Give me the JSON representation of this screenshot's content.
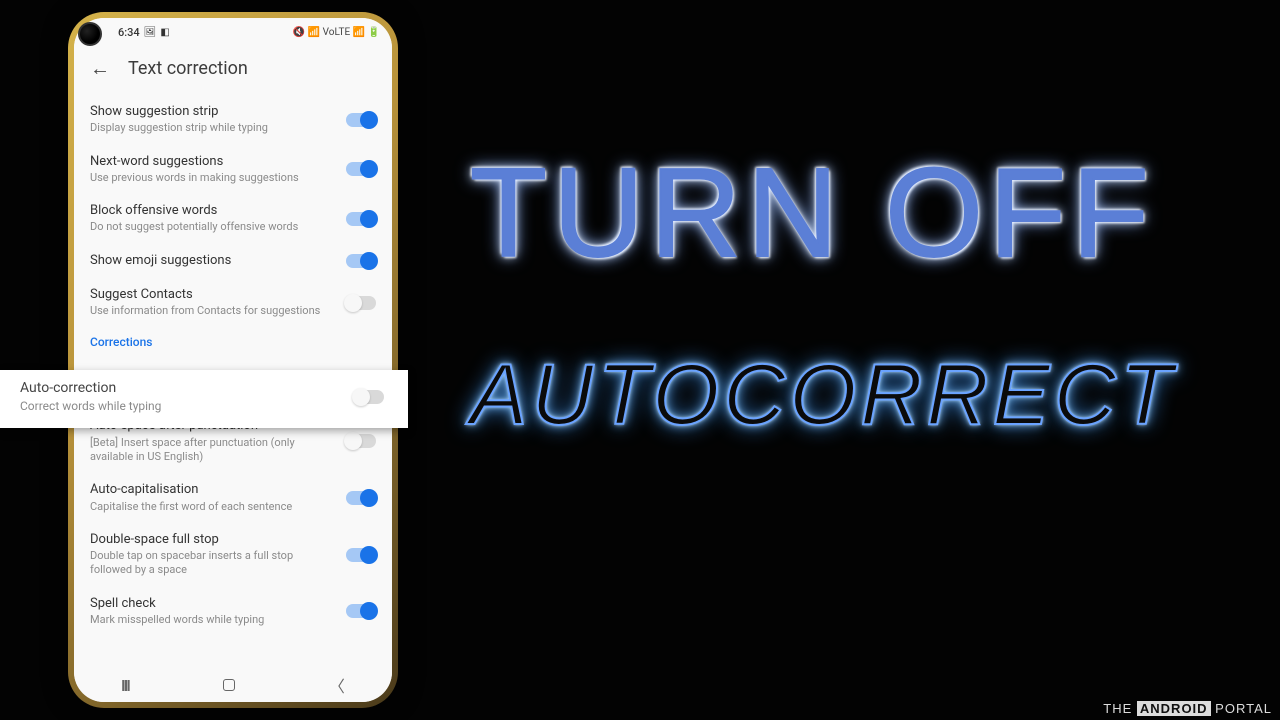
{
  "status": {
    "time": "6:34",
    "icons": "🔇 📶 VoLTE 📶 🔋"
  },
  "header": {
    "title": "Text correction"
  },
  "settings": [
    {
      "title": "Show suggestion strip",
      "sub": "Display suggestion strip while typing",
      "on": true
    },
    {
      "title": "Next-word suggestions",
      "sub": "Use previous words in making suggestions",
      "on": true
    },
    {
      "title": "Block offensive words",
      "sub": "Do not suggest potentially offensive words",
      "on": true
    },
    {
      "title": "Show emoji suggestions",
      "sub": "",
      "on": true
    },
    {
      "title": "Suggest Contacts",
      "sub": "Use information from Contacts for suggestions",
      "on": false
    }
  ],
  "section_label": "Corrections",
  "highlight": {
    "title": "Auto-correction",
    "sub": "Correct words while typing",
    "on": false
  },
  "settings2": [
    {
      "title": "Auto-space after punctuation",
      "sub": "[Beta] Insert space after punctuation (only available in US English)",
      "on": false
    },
    {
      "title": "Auto-capitalisation",
      "sub": "Capitalise the first word of each sentence",
      "on": true
    },
    {
      "title": "Double-space full stop",
      "sub": "Double tap on spacebar inserts a full stop followed by a space",
      "on": true
    },
    {
      "title": "Spell check",
      "sub": "Mark misspelled words while typing",
      "on": true
    }
  ],
  "hero": {
    "line1": "TURN OFF",
    "line2": "AUTOCORRECT"
  },
  "watermark": {
    "pre": "THE ",
    "accent": "ANDROID",
    "post": " PORTAL"
  }
}
